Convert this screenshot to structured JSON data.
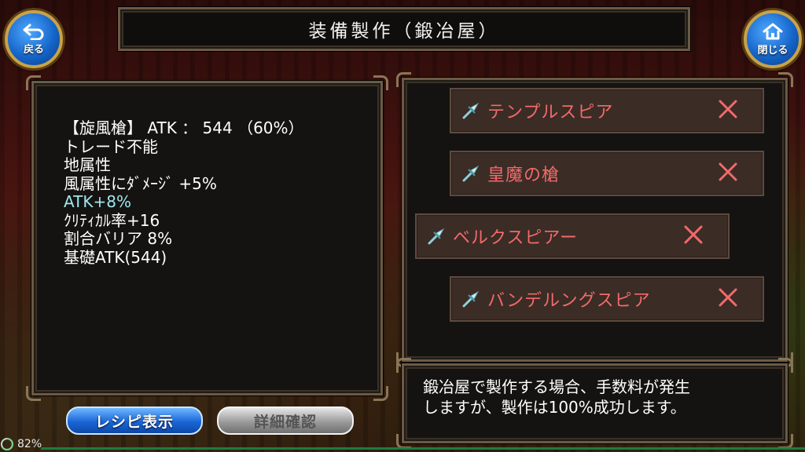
{
  "header": {
    "title": "装備製作（鍛冶屋）",
    "back_label": "戻る",
    "close_label": "閉じる"
  },
  "item_details": {
    "lines": [
      "【旋風槍】 ATK ： 544 （60%）",
      "トレード不能",
      "地属性",
      "風属性にﾀﾞﾒｰｼﾞ +5%",
      "ATK+8%",
      "ｸﾘﾃｨｶﾙ率+16",
      "割合バリア 8%",
      "基礎ATK(544)"
    ],
    "highlight_color": "#9fe6ee"
  },
  "recipes": [
    {
      "name": "テンプルスピア",
      "icon": "spear-icon",
      "status": "cross-mark-icon"
    },
    {
      "name": "皇魔の槍",
      "icon": "spear-icon",
      "status": "cross-mark-icon"
    },
    {
      "name": "ベルクスピアー",
      "icon": "spear-icon",
      "status": "cross-mark-icon"
    },
    {
      "name": "バンデルングスピア",
      "icon": "spear-icon",
      "status": "cross-mark-icon"
    }
  ],
  "info": {
    "text_line1": "鍛冶屋で製作する場合、手数料が発生",
    "text_line2": "しますが、製作は100%成功します。"
  },
  "buttons": {
    "recipe_display": "レシピ表示",
    "detail_confirm": "詳細確認"
  },
  "status": {
    "battery": "82%"
  },
  "colors": {
    "recipe_name": "#f26a6a",
    "recipe_bg": "#3b2c26",
    "accent_blue": "#1566c9",
    "frame_gold": "#c9a24a"
  }
}
